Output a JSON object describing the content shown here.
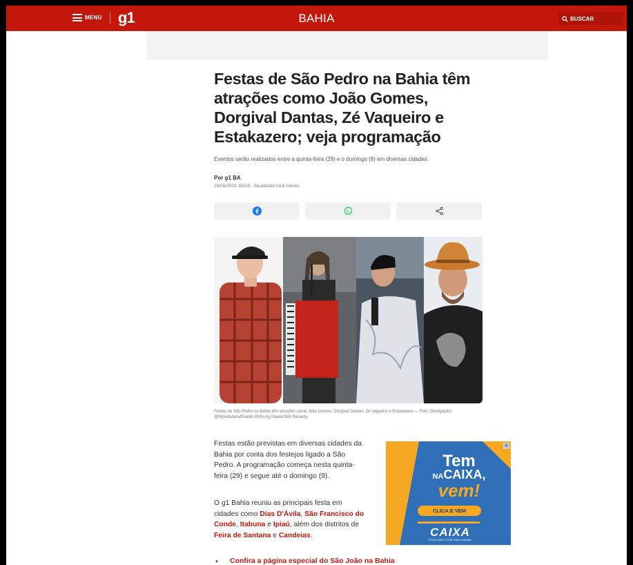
{
  "header": {
    "menu_label": "MENU",
    "logo": "g1",
    "region": "BAHIA",
    "search_label": "BUSCAR"
  },
  "article": {
    "headline": "Festas de São Pedro na Bahia têm atrações como João Gomes, Dorgival Dantas, Zé Vaqueiro e Estakazero; veja programação",
    "subtitle": "Eventos serão realizados entre a quinta-feira (29) e o domingo (9) em diversas cidades.",
    "byline": "Por g1 BA",
    "date": "29/06/2023 15h15 · Atualizado há 8 meses",
    "share_icons": [
      "facebook-icon",
      "whatsapp-icon",
      "share-icon"
    ],
    "photo_caption": "Festas de São Pedro na Bahia têm atrações como João Gomes, Dorgival Dantas, Zé Vaqueiro e Estakazero — Foto: Divulgação/ @r5produtora/Enaldo Pinto Ag Haack/Will Recarey",
    "paragraph1": "Festas estão previstas em diversas cidades da Bahia por conta dos festejos ligado a São Pedro. A programação começa nesta quinta-feira (29) e segue até o domingo (9).",
    "paragraph2": {
      "t1": "O g1 Bahia reuniu as principais festa em cidades como ",
      "link1": "Dias D'Ávila",
      "t2": ", ",
      "link2": "São Francisco do Conde",
      "t3": ", ",
      "link3": "Itabuna",
      "t4": " e ",
      "link4": "Ipiaú",
      "t5": ", além dos distritos de ",
      "link5": "Feira de Santana",
      "t6": " e ",
      "link6": "Candeias",
      "t7": "."
    },
    "bullet_link": "Confira a página especial do São João na Bahia"
  },
  "ad": {
    "line1": "Tem",
    "line2a": "NA",
    "line2b": "CAIXA,",
    "line3": "vem!",
    "cta": "CLICA E VEM",
    "brand": "CAIXA",
    "tagline": "É POR VOCÊ, É POR TODO O BRASIL",
    "close": "×"
  },
  "colors": {
    "brand_red": "#c4170c",
    "ad_blue": "#2f6fb7",
    "ad_orange": "#f7a823",
    "facebook": "#1877f2",
    "whatsapp": "#25d366"
  }
}
